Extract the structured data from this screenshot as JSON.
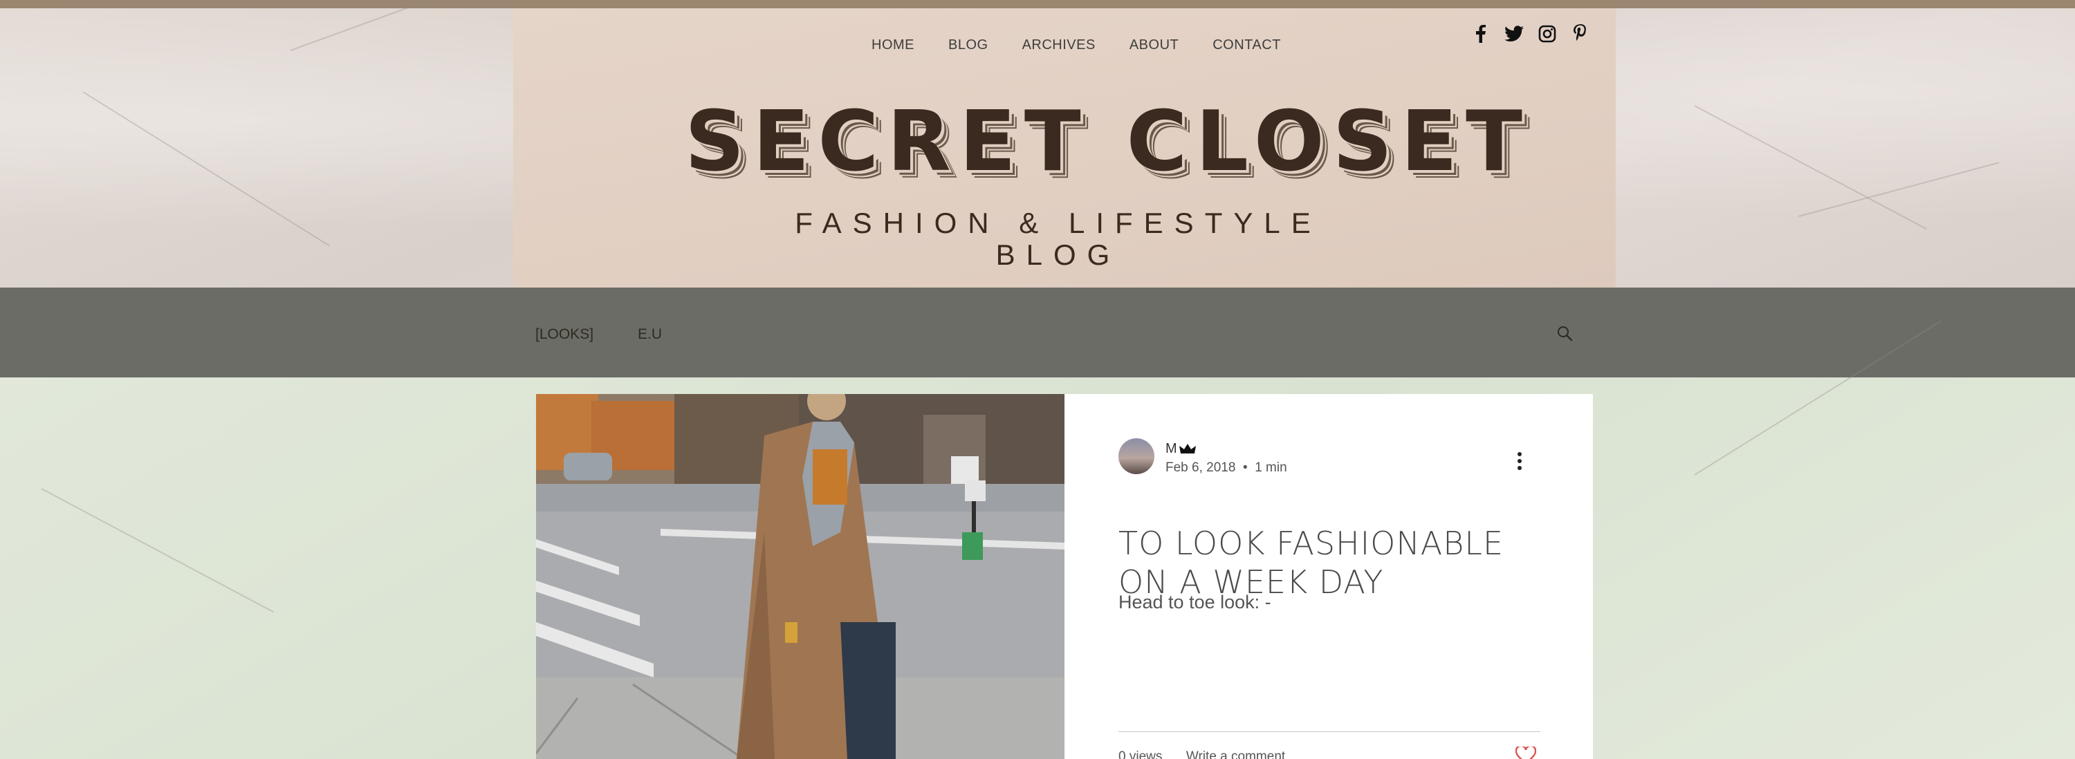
{
  "header": {
    "nav": [
      "HOME",
      "BLOG",
      "ARCHIVES",
      "ABOUT",
      "CONTACT"
    ],
    "social": [
      "facebook-icon",
      "twitter-icon",
      "instagram-icon",
      "pinterest-icon"
    ],
    "logo": "SECRET CLOSET",
    "tagline_line1": "FASHION & LIFESTYLE",
    "tagline_line2": "BLOG"
  },
  "categories": [
    "[LOOKS]",
    "E.U"
  ],
  "post": {
    "author": "M",
    "date": "Feb 6, 2018",
    "read_time": "1 min",
    "title": "TO LOOK FASHIONABLE ON A WEEK DAY",
    "excerpt": "Head to toe look: -",
    "views": "0 views",
    "comment_label": "Write a comment"
  },
  "colors": {
    "accent_top": "#9a8570",
    "logo_text": "#3a2a1f",
    "category_bar": "#6b6c66",
    "heart": "#d9534f"
  }
}
